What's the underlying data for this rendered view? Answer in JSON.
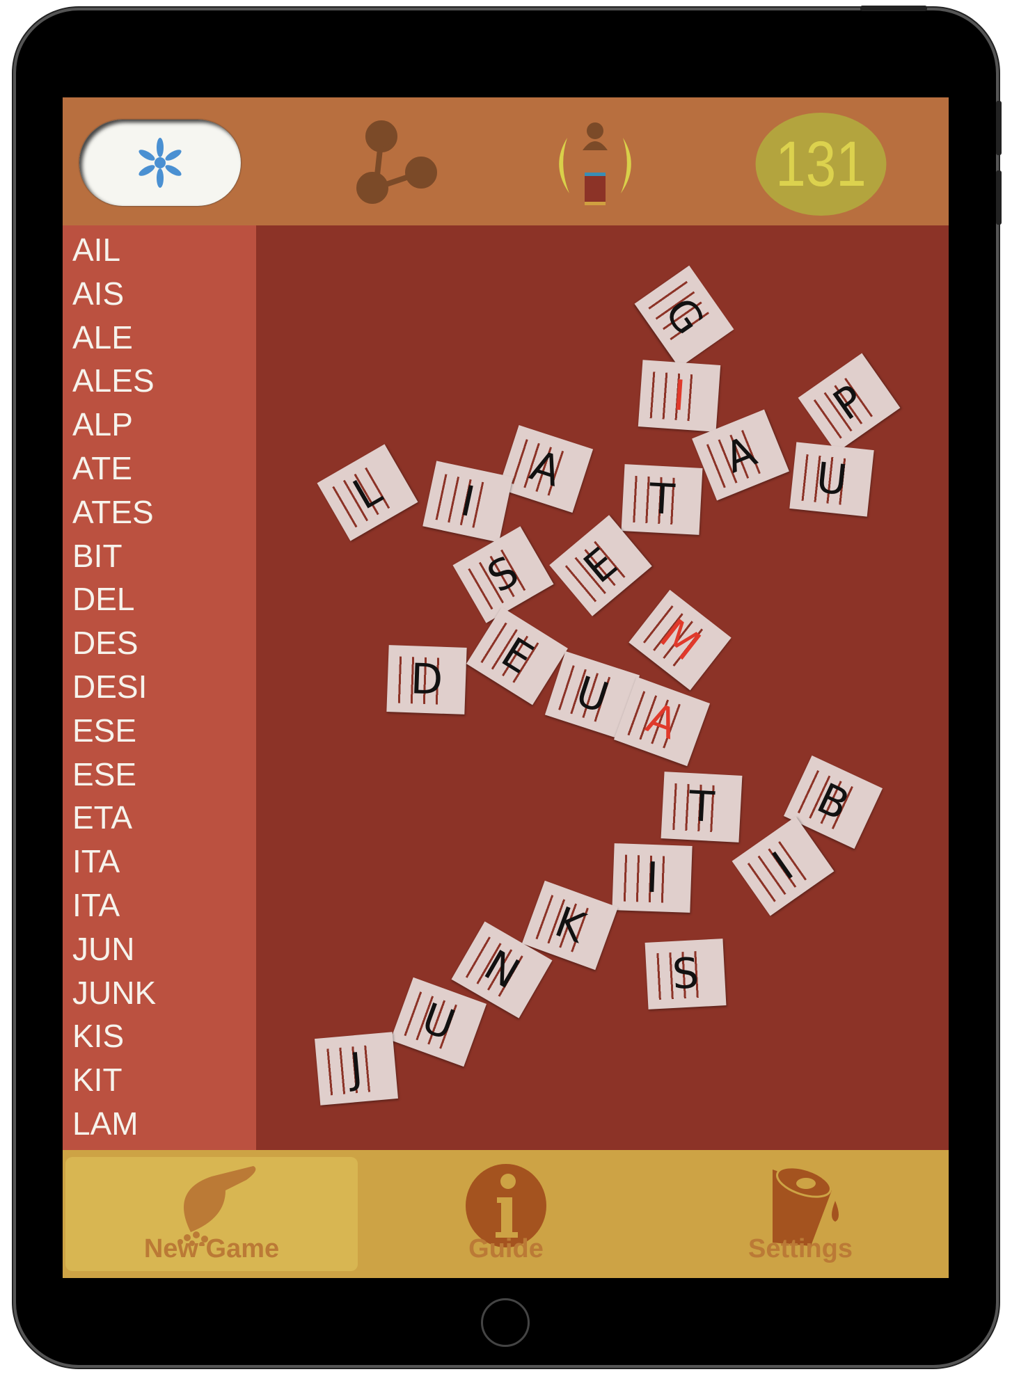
{
  "header": {
    "menu_icon": "asterisk-icon",
    "share_icon": "share-icon",
    "player_icon": "player-trophy-icon",
    "score": "131"
  },
  "words": [
    "AIL",
    "AIS",
    "ALE",
    "ALES",
    "ALP",
    "ATE",
    "ATES",
    "BIT",
    "DEL",
    "DES",
    "DESI",
    "ESE",
    "ESE",
    "ETA",
    "ITA",
    "ITA",
    "JUN",
    "JUNK",
    "KIS",
    "KIT",
    "LAM"
  ],
  "tiles": [
    {
      "letter": "G",
      "color": "#111111",
      "rot": 55
    },
    {
      "letter": "I",
      "color": "#e0392b",
      "rot": 4
    },
    {
      "letter": "P",
      "color": "#111111",
      "rot": -35
    },
    {
      "letter": "A",
      "color": "#111111",
      "rot": -22
    },
    {
      "letter": "U",
      "color": "#111111",
      "rot": 6
    },
    {
      "letter": "L",
      "color": "#111111",
      "rot": -30
    },
    {
      "letter": "A",
      "color": "#111111",
      "rot": 18
    },
    {
      "letter": "I",
      "color": "#111111",
      "rot": 12
    },
    {
      "letter": "T",
      "color": "#111111",
      "rot": 3
    },
    {
      "letter": "S",
      "color": "#111111",
      "rot": -30
    },
    {
      "letter": "E",
      "color": "#111111",
      "rot": -40
    },
    {
      "letter": "M",
      "color": "#e0392b",
      "rot": 38
    },
    {
      "letter": "D",
      "color": "#111111",
      "rot": 2
    },
    {
      "letter": "E",
      "color": "#111111",
      "rot": 32
    },
    {
      "letter": "U",
      "color": "#111111",
      "rot": 18
    },
    {
      "letter": "A",
      "color": "#e0392b",
      "rot": 20
    },
    {
      "letter": "T",
      "color": "#111111",
      "rot": 3
    },
    {
      "letter": "B",
      "color": "#111111",
      "rot": 25
    },
    {
      "letter": "I",
      "color": "#111111",
      "rot": -35
    },
    {
      "letter": "I",
      "color": "#111111",
      "rot": 2
    },
    {
      "letter": "K",
      "color": "#111111",
      "rot": 20
    },
    {
      "letter": "S",
      "color": "#111111",
      "rot": -3
    },
    {
      "letter": "N",
      "color": "#111111",
      "rot": 30
    },
    {
      "letter": "U",
      "color": "#111111",
      "rot": 20
    },
    {
      "letter": "J",
      "color": "#111111",
      "rot": -5
    }
  ],
  "tabs": [
    {
      "label": "New Game",
      "icon": "scoop-icon",
      "active": true
    },
    {
      "label": "Guide",
      "icon": "info-icon",
      "active": false
    },
    {
      "label": "Settings",
      "icon": "cup-icon",
      "active": false
    }
  ]
}
